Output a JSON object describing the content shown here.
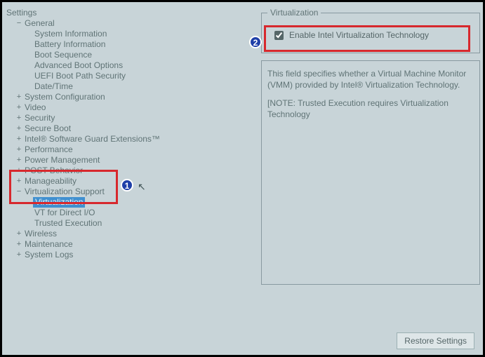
{
  "tree": {
    "root": "Settings",
    "general": {
      "label": "General",
      "children": {
        "sysinfo": "System Information",
        "battinfo": "Battery Information",
        "bootseq": "Boot Sequence",
        "advboot": "Advanced Boot Options",
        "uefisec": "UEFI Boot Path Security",
        "datetime": "Date/Time"
      }
    },
    "sysconf": "System Configuration",
    "video": "Video",
    "security": "Security",
    "secureboot": "Secure Boot",
    "sgx": "Intel® Software Guard Extensions™",
    "performance": "Performance",
    "power": "Power Management",
    "post": "POST Behavior",
    "manageability": "Manageability",
    "virt": {
      "label": "Virtualization Support",
      "children": {
        "virtualization": "Virtualization",
        "vtio": "VT for Direct I/O",
        "trusted": "Trusted Execution"
      }
    },
    "wireless": "Wireless",
    "maintenance": "Maintenance",
    "syslogs": "System Logs"
  },
  "panel": {
    "legend": "Virtualization",
    "checkbox_label": "Enable Intel Virtualization Technology",
    "desc1": "This field specifies whether a Virtual Machine Monitor (VMM) provided by Intel® Virtualization Technology.",
    "desc2": "[NOTE: Trusted Execution requires Virtualization Technology"
  },
  "buttons": {
    "restore": "Restore Settings"
  },
  "annotations": {
    "badge1": "1",
    "badge2": "2"
  }
}
